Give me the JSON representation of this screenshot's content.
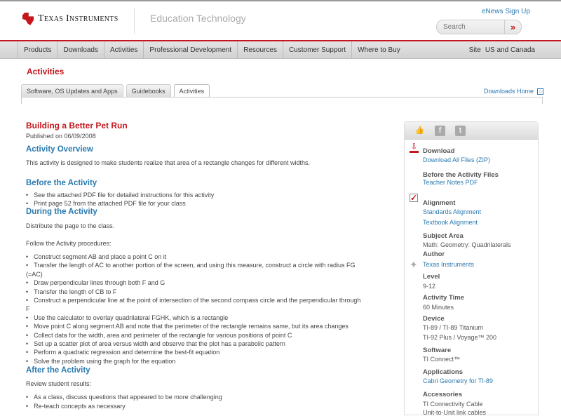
{
  "header": {
    "brand": "Texas Instruments",
    "section": "Education Technology",
    "enews": "eNews Sign Up",
    "search_placeholder": "Search",
    "search_go": "»"
  },
  "nav": {
    "items": [
      "Products",
      "Downloads",
      "Activities",
      "Professional Development",
      "Resources",
      "Customer Support",
      "Where to Buy"
    ],
    "site_label": "Site",
    "site_value": "US and Canada"
  },
  "page_title": "Activities",
  "tabs": [
    "Software, OS Updates and Apps",
    "Guidebooks",
    "Activities"
  ],
  "downloads_home": "Downloads Home",
  "article": {
    "title": "Building a Better Pet Run",
    "published": "Published on 06/09/2008",
    "overview_h": "Activity Overview",
    "overview": "This activity is designed to make students realize that area of a rectangle changes for different widths.",
    "before_h": "Before the Activity",
    "before": [
      "See the attached PDF file for detailed instructions for this activity",
      "Print page 52 from the attached PDF file for your class"
    ],
    "during_h": "During the Activity",
    "during_intro": "Distribute the page to the class.",
    "during_follow": "Follow the Activity procedures:",
    "during_lines": [
      {
        "t": "Construct segment AB and place a point C on it",
        "b": true
      },
      {
        "t": "Transfer the length of AC to another portion of the screen, and using this measure, construct a circle with radius FG",
        "b": true
      },
      {
        "t": "(=AC)",
        "b": false
      },
      {
        "t": "Draw perpendicular lines through both F and G",
        "b": true
      },
      {
        "t": "Transfer the length of CB to F",
        "b": true
      },
      {
        "t": "Construct a perpendicular line at the point of intersection of the second compass circle and the perpendicular through",
        "b": true
      },
      {
        "t": "F",
        "b": false
      },
      {
        "t": "Use the calculator to overlay quadrilateral FGHK, which is a rectangle",
        "b": true
      },
      {
        "t": "Move point C along segment AB and note that the perimeter of the rectangle remains same, but its area changes",
        "b": true
      },
      {
        "t": "Collect data for the width, area and perimeter of the rectangle for various positions of point C",
        "b": true
      },
      {
        "t": "Set up a scatter plot of area versus width and observe that the plot has a parabolic pattern",
        "b": true
      },
      {
        "t": "Perform a quadratic regression and determine the best-fit equation",
        "b": true
      },
      {
        "t": "Solve the problem using the graph for the equation",
        "b": true
      }
    ],
    "after_h": "After the Activity",
    "after_intro": "Review student results:",
    "after": [
      "As a class, discuss questions that appeared to be more challenging",
      "Re-teach concepts as necessary"
    ]
  },
  "sidebar": {
    "download_h": "Download",
    "download_link": "Download All Files (ZIP)",
    "before_files_h": "Before the Activity Files",
    "teacher_notes": "Teacher Notes PDF",
    "alignment_h": "Alignment",
    "standards": "Standards Alignment",
    "textbook": "Textbook Alignment",
    "subject_h": "Subject Area",
    "subject": "Math: Geometry: Quadrilaterals",
    "author_h": "Author",
    "author": "Texas Instruments",
    "level_h": "Level",
    "level": "9-12",
    "time_h": "Activity Time",
    "time": "60 Minutes",
    "device_h": "Device",
    "devices": [
      "TI-89 / TI-89 Titanium",
      "TI-92 Plus / Voyage™ 200"
    ],
    "software_h": "Software",
    "software": "TI Connect™",
    "apps_h": "Applications",
    "app": "Cabri Geometry for TI-89",
    "acc_h": "Accessories",
    "accessories": [
      "TI Connectivity Cable",
      "Unit-to-Unit link cables"
    ]
  },
  "colors": {
    "brand_red": "#c4161c",
    "link_blue": "#2a7ab0"
  }
}
